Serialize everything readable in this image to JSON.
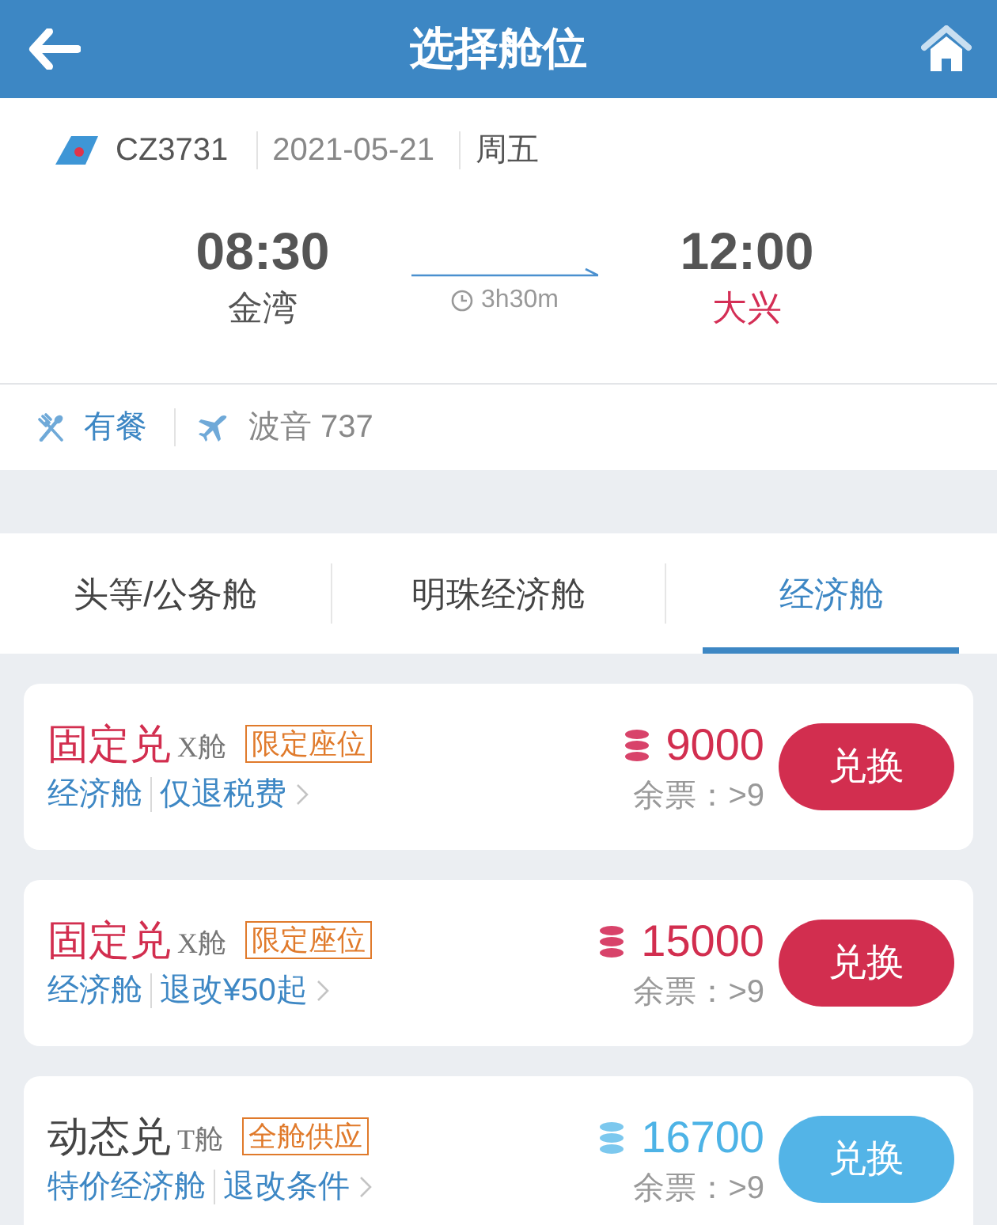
{
  "header": {
    "title": "选择舱位"
  },
  "flight": {
    "number": "CZ3731",
    "date": "2021-05-21",
    "weekday": "周五",
    "departure": {
      "time": "08:30",
      "airport": "金湾"
    },
    "duration": "3h30m",
    "arrival": {
      "time": "12:00",
      "airport": "大兴"
    },
    "meal": "有餐",
    "aircraft": "波音 737"
  },
  "tabs": [
    {
      "label": "头等/公务舱",
      "selected": false
    },
    {
      "label": "明珠经济舱",
      "selected": false
    },
    {
      "label": "经济舱",
      "selected": true
    }
  ],
  "fares": [
    {
      "kind": "fixed",
      "name": "固定兑",
      "cabin": "X舱",
      "tag": "限定座位",
      "fare_class": "经济舱",
      "rule": "仅退税费",
      "price": "9000",
      "remaining": "余票：>9",
      "button": "兑换"
    },
    {
      "kind": "fixed",
      "name": "固定兑",
      "cabin": "X舱",
      "tag": "限定座位",
      "fare_class": "经济舱",
      "rule": "退改¥50起",
      "price": "15000",
      "remaining": "余票：>9",
      "button": "兑换"
    },
    {
      "kind": "dynamic",
      "name": "动态兑",
      "cabin": "T舱",
      "tag": "全舱供应",
      "fare_class": "特价经济舱",
      "rule": "退改条件",
      "price": "16700",
      "remaining": "余票：>9",
      "button": "兑换"
    }
  ]
}
